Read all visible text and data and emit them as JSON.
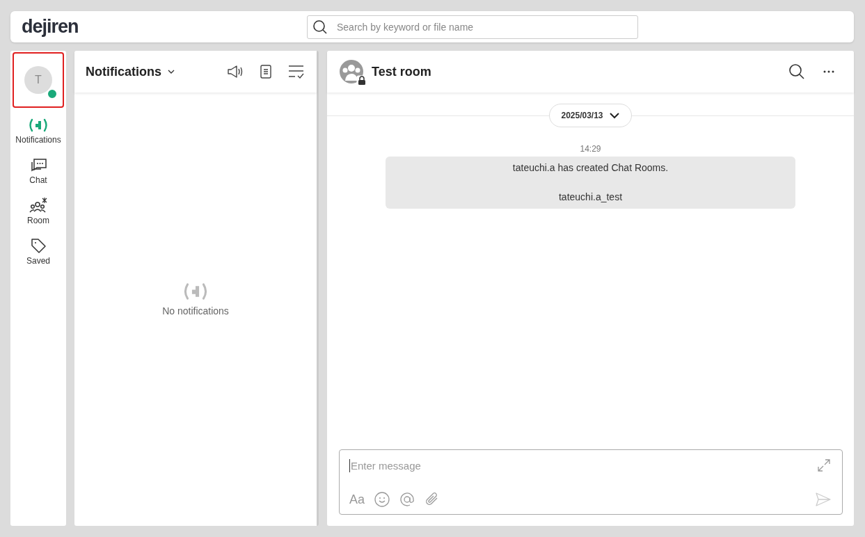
{
  "header": {
    "logo": "dejiren",
    "search": {
      "placeholder": "Search by keyword or file name"
    }
  },
  "sidebar": {
    "profile": {
      "initial": "T",
      "online": true,
      "selected": true
    },
    "items": [
      {
        "kind": "notifications",
        "label": "Notifications",
        "selected": true
      },
      {
        "kind": "chat",
        "label": "Chat",
        "selected": false
      },
      {
        "kind": "room",
        "label": "Room",
        "selected": false
      },
      {
        "kind": "saved",
        "label": "Saved",
        "selected": false
      }
    ]
  },
  "notifications_panel": {
    "title": "Notifications",
    "empty_text": "No notifications"
  },
  "chat": {
    "room_name": "Test room",
    "locked": true,
    "date": "2025/03/13",
    "messages": [
      {
        "time": "14:29",
        "text": "tateuchi.a has created Chat Rooms.\n\ntateuchi.a_test"
      }
    ],
    "composer": {
      "placeholder": "Enter message",
      "format_label": "Aa"
    }
  }
}
